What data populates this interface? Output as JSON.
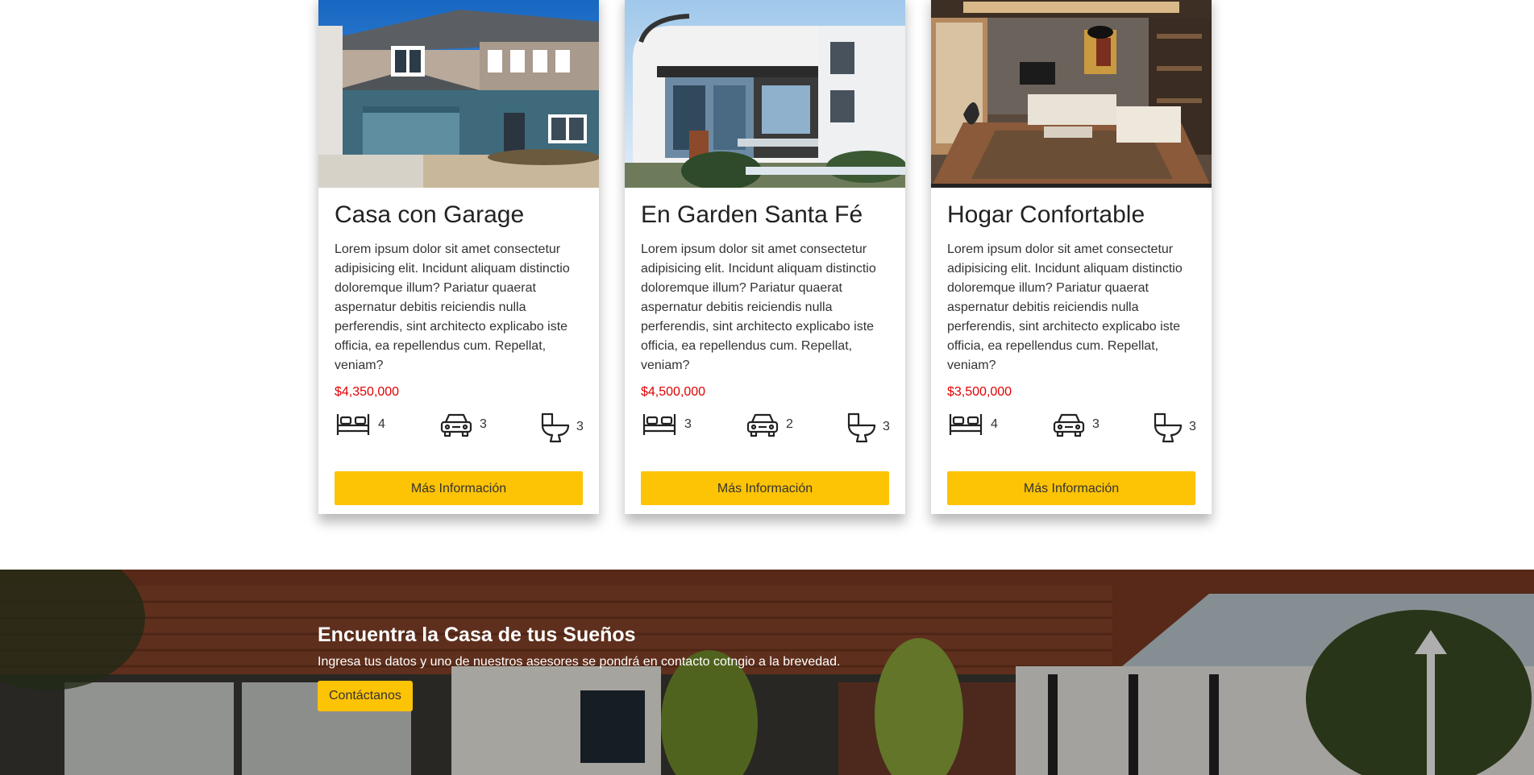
{
  "colors": {
    "accent": "#fdc305",
    "price": "#e00000"
  },
  "cards": [
    {
      "title": "Casa con Garage",
      "description": "Lorem ipsum dolor sit amet consectetur adipisicing elit. Incidunt aliquam distinctio doloremque illum? Pariatur quaerat aspernatur debitis reiciendis nulla perferendis, sint architecto explicabo iste officia, ea repellendus cum. Repellat, veniam?",
      "price": "$4,350,000",
      "bedrooms": "4",
      "parking": "3",
      "bathrooms": "3",
      "button": "Más Información"
    },
    {
      "title": "En Garden Santa Fé",
      "description": "Lorem ipsum dolor sit amet consectetur adipisicing elit. Incidunt aliquam distinctio doloremque illum? Pariatur quaerat aspernatur debitis reiciendis nulla perferendis, sint architecto explicabo iste officia, ea repellendus cum. Repellat, veniam?",
      "price": "$4,500,000",
      "bedrooms": "3",
      "parking": "2",
      "bathrooms": "3",
      "button": "Más Información"
    },
    {
      "title": "Hogar Confortable",
      "description": "Lorem ipsum dolor sit amet consectetur adipisicing elit. Incidunt aliquam distinctio doloremque illum? Pariatur quaerat aspernatur debitis reiciendis nulla perferendis, sint architecto explicabo iste officia, ea repellendus cum. Repellat, veniam?",
      "price": "$3,500,000",
      "bedrooms": "4",
      "parking": "3",
      "bathrooms": "3",
      "button": "Más Información"
    }
  ],
  "icons": {
    "bed": "bed-icon",
    "car": "car-icon",
    "toilet": "toilet-icon"
  },
  "banner": {
    "title": "Encuentra la Casa de tus Sueños",
    "text": "Ingresa tus datos y uno de nuestros asesores se pondrá en contacto cotngio a la brevedad.",
    "button": "Contáctanos"
  }
}
